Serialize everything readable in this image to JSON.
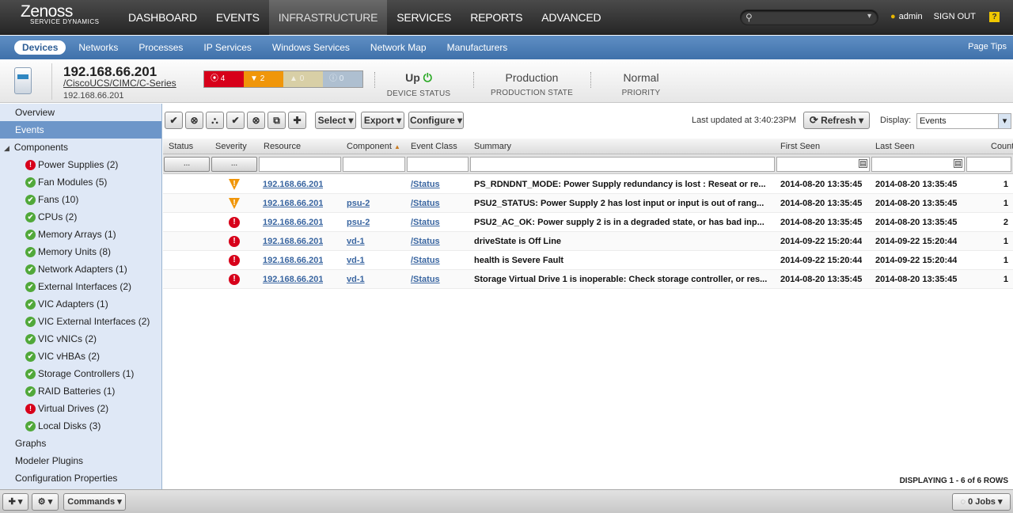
{
  "brand": {
    "name": "Zenoss",
    "tagline": "SERVICE DYNAMICS"
  },
  "main_nav": [
    "DASHBOARD",
    "EVENTS",
    "INFRASTRUCTURE",
    "SERVICES",
    "REPORTS",
    "ADVANCED"
  ],
  "user": {
    "name": "admin",
    "signout": "SIGN OUT",
    "help": "?"
  },
  "sub_nav": [
    "Devices",
    "Networks",
    "Processes",
    "IP Services",
    "Windows Services",
    "Network Map",
    "Manufacturers"
  ],
  "page_tips": "Page Tips",
  "device": {
    "name": "192.168.66.201",
    "path": "/CiscoUCS/CIMC/C-Series",
    "ip": "192.168.66.201",
    "severity_counts": {
      "critical": "4",
      "error": "2",
      "warning": "0",
      "info": "0"
    },
    "status_value": "Up",
    "status_label": "DEVICE STATUS",
    "production_value": "Production",
    "production_label": "PRODUCTION STATE",
    "priority_value": "Normal",
    "priority_label": "PRIORITY"
  },
  "sidebar": {
    "top": [
      "Overview",
      "Events"
    ],
    "components_label": "Components",
    "components": [
      {
        "label": "Power Supplies (2)",
        "status": "crit"
      },
      {
        "label": "Fan Modules (5)",
        "status": "ok"
      },
      {
        "label": "Fans (10)",
        "status": "ok"
      },
      {
        "label": "CPUs (2)",
        "status": "ok"
      },
      {
        "label": "Memory Arrays (1)",
        "status": "ok"
      },
      {
        "label": "Memory Units (8)",
        "status": "ok"
      },
      {
        "label": "Network Adapters (1)",
        "status": "ok"
      },
      {
        "label": "External Interfaces (2)",
        "status": "ok"
      },
      {
        "label": "VIC Adapters (1)",
        "status": "ok"
      },
      {
        "label": "VIC External Interfaces (2)",
        "status": "ok"
      },
      {
        "label": "VIC vNICs (2)",
        "status": "ok"
      },
      {
        "label": "VIC vHBAs (2)",
        "status": "ok"
      },
      {
        "label": "Storage Controllers (1)",
        "status": "ok"
      },
      {
        "label": "RAID Batteries (1)",
        "status": "ok"
      },
      {
        "label": "Virtual Drives (2)",
        "status": "crit"
      },
      {
        "label": "Local Disks (3)",
        "status": "ok"
      }
    ],
    "bottom": [
      "Graphs",
      "Modeler Plugins",
      "Configuration Properties"
    ]
  },
  "toolbar": {
    "select": "Select",
    "export": "Export",
    "configure": "Configure",
    "last_updated": "Last updated at 3:40:23PM",
    "refresh": "Refresh",
    "display_label": "Display:",
    "display_value": "Events"
  },
  "grid": {
    "columns": [
      "Status",
      "Severity",
      "Resource",
      "Component",
      "Event Class",
      "Summary",
      "First Seen",
      "Last Seen",
      "Count"
    ],
    "filter_btn": "...",
    "rows": [
      {
        "sev": "warn",
        "resource": "192.168.66.201",
        "component": "",
        "event_class": "/Status",
        "summary": "PS_RDNDNT_MODE: Power Supply redundancy is lost : Reseat or re...",
        "first": "2014-08-20 13:35:45",
        "last": "2014-08-20 13:35:45",
        "count": "1"
      },
      {
        "sev": "warn",
        "resource": "192.168.66.201",
        "component": "psu-2",
        "event_class": "/Status",
        "summary": "PSU2_STATUS: Power Supply 2 has lost input or input is out of rang...",
        "first": "2014-08-20 13:35:45",
        "last": "2014-08-20 13:35:45",
        "count": "1"
      },
      {
        "sev": "crit",
        "resource": "192.168.66.201",
        "component": "psu-2",
        "event_class": "/Status",
        "summary": "PSU2_AC_OK: Power supply 2 is in a degraded state, or has bad inp...",
        "first": "2014-08-20 13:35:45",
        "last": "2014-08-20 13:35:45",
        "count": "2"
      },
      {
        "sev": "crit",
        "resource": "192.168.66.201",
        "component": "vd-1",
        "event_class": "/Status",
        "summary": "driveState is Off Line",
        "first": "2014-09-22 15:20:44",
        "last": "2014-09-22 15:20:44",
        "count": "1"
      },
      {
        "sev": "crit",
        "resource": "192.168.66.201",
        "component": "vd-1",
        "event_class": "/Status",
        "summary": "health is Severe Fault",
        "first": "2014-09-22 15:20:44",
        "last": "2014-09-22 15:20:44",
        "count": "1"
      },
      {
        "sev": "crit",
        "resource": "192.168.66.201",
        "component": "vd-1",
        "event_class": "/Status",
        "summary": "Storage Virtual Drive 1 is inoperable: Check storage controller, or res...",
        "first": "2014-08-20 13:35:45",
        "last": "2014-08-20 13:35:45",
        "count": "1"
      }
    ],
    "displaying": "DISPLAYING 1 - 6 of 6 ROWS"
  },
  "footer": {
    "commands": "Commands",
    "jobs": "0 Jobs"
  }
}
